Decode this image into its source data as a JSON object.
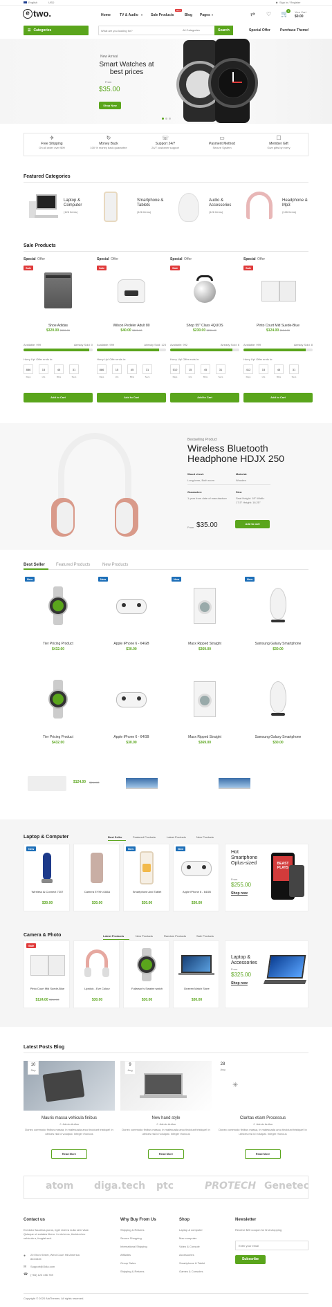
{
  "topbar": {
    "language": "English",
    "currency": "USD",
    "account": "Sign in / Register"
  },
  "header": {
    "logo": "two.",
    "logo_prefix": "e",
    "nav": [
      "Home",
      "TV & Audio",
      "Sale Products",
      "Blog",
      "Pages"
    ],
    "hot_badge": "HOT",
    "cart_label": "Your Cart",
    "cart_total": "$0.00",
    "cart_count": "0"
  },
  "searchbar": {
    "categories_label": "Categories",
    "placeholder": "What are you looking for?",
    "select": "All Categories",
    "search_button": "Search",
    "links": [
      "Special Offer",
      "Purchase Theme!"
    ]
  },
  "hero": {
    "tag": "New Arrival",
    "title": "Smart Watches at best prices",
    "from": "From",
    "price": "$35.00",
    "button": "Shop Now"
  },
  "features": [
    {
      "title": "Free Shipping",
      "sub": "On all order over $99"
    },
    {
      "title": "Money Back",
      "sub": "100 % money back guarantee"
    },
    {
      "title": "Support 24/7",
      "sub": "24/7 customer support"
    },
    {
      "title": "Payment Method",
      "sub": "Secure System"
    },
    {
      "title": "Member Gift",
      "sub": "Give gifts by every"
    }
  ],
  "featured_categories": {
    "title": "Featured Categories",
    "items": [
      {
        "name": "Laptop & Computer",
        "count": "(126 Items)"
      },
      {
        "name": "Smartphone & Tablets",
        "count": "(126 Items)"
      },
      {
        "name": "Audio & Accessories",
        "count": "(126 Items)"
      },
      {
        "name": "Headphone & Mp3",
        "count": "(126 Items)"
      }
    ]
  },
  "sale_products": {
    "title": "Sale Products",
    "special": "Special",
    "offer": "Offer",
    "sale": "Sale",
    "hurry": "Hurry Up! Offer ends in:",
    "add_to_cart": "Add to Cart",
    "labels": [
      "Days",
      "Hrs",
      "Mins",
      "Secs"
    ],
    "items": [
      {
        "name": "Shoe Adidas",
        "price": "$320.00",
        "old": "$350.00",
        "available": "Available: 999",
        "sold": "Already Sold: 0",
        "fill": 0.95,
        "cd": [
          "886",
          "15",
          "45",
          "31"
        ]
      },
      {
        "name": "Wilson Pedeler Adult 80",
        "price": "$40.00",
        "old": "$120.00",
        "available": "Available: 999",
        "sold": "Already Sold: 123",
        "fill": 0.9,
        "cd": [
          "886",
          "15",
          "45",
          "31"
        ]
      },
      {
        "name": "Shop 55\" Class 4QUOS",
        "price": "$230.00",
        "old": "$250.00",
        "available": "Available: 992",
        "sold": "Already Sold: 6",
        "fill": 0.9,
        "cd": [
          "510",
          "15",
          "45",
          "31"
        ]
      },
      {
        "name": "Pinto Court Mid Suede-Blue",
        "price": "$124.00",
        "old": "$154.00",
        "available": "Available: 999",
        "sold": "Already Sold: 8",
        "fill": 0.9,
        "cd": [
          "412",
          "15",
          "45",
          "31"
        ]
      }
    ]
  },
  "promo": {
    "tag": "Bestselling Product",
    "title": "Wireless Bluetooth Headphone HDJX 250",
    "specs": [
      {
        "label": "Wood chest:",
        "value": "Long-term, Both room"
      },
      {
        "label": "Material:",
        "value": "Wooden"
      },
      {
        "label": "Guarantee:",
        "value": "1 year from date of manufacture"
      },
      {
        "label": "Size:",
        "value": "Seat Height: 18\" Width: 17.5\" Height: 16.25\""
      }
    ],
    "from": "From",
    "price": "$35.00",
    "button": "Add to cart"
  },
  "bestseller": {
    "tabs": [
      "Best Seller",
      "Featured Products",
      "New Products"
    ],
    "new": "New",
    "items": [
      {
        "name": "Tier Pricing Product",
        "price": "$432.00"
      },
      {
        "name": "Apple iPhone 6 - 64GB",
        "price": "$30.00"
      },
      {
        "name": "Maxx Ripped Straight",
        "price": "$369.00"
      },
      {
        "name": "Samsung Galaxy Smartphone",
        "price": "$30.00"
      },
      {
        "name": "Tier Pricing Product",
        "price": "$432.00"
      },
      {
        "name": "Apple iPhone 6 - 64GB",
        "price": "$30.00"
      },
      {
        "name": "Maxx Ripped Straight",
        "price": "$369.00"
      },
      {
        "name": "Samsung Galaxy Smartphone",
        "price": "$30.00"
      }
    ],
    "strip": {
      "price": "$124.00",
      "old": "$154.00"
    }
  },
  "laptop": {
    "title": "Laptop & Computer",
    "tabs": [
      "Best Seller",
      "Featured Products",
      "Latest Products",
      "New Products"
    ],
    "new": "New",
    "items": [
      {
        "name": "Wireless Ai Connect 7207",
        "price": "$30.00"
      },
      {
        "name": "Camera EYKH-0A5A",
        "price": "$30.00"
      },
      {
        "name": "Smartphone And Tablet",
        "price": "$30.00"
      },
      {
        "name": "Apple iPhone 6 - 64GB",
        "price": "$30.00"
      }
    ],
    "ad": {
      "title": "Hot Smartphone Oplus-sized",
      "from": "From",
      "price": "$255.00",
      "link": "Shop now",
      "screen": "BEAST PLAYS"
    }
  },
  "camera": {
    "title": "Camera & Photo",
    "tabs": [
      "Latest Products",
      "New Products",
      "Random Products",
      "Sale Products"
    ],
    "sale": "Sale",
    "items": [
      {
        "name": "Pinto Court Mid Suede-Blue",
        "price": "$124.00",
        "old": "$154.00"
      },
      {
        "name": "Lipstick - Eve Colour",
        "price": "$30.00",
        "old": ""
      },
      {
        "name": "Fullarson's Swaine watch",
        "price": "$30.00",
        "old": ""
      },
      {
        "name": "Dezeen Match Store",
        "price": "$30.00",
        "old": ""
      }
    ],
    "ad": {
      "title": "Laptop & Accessories",
      "from": "From",
      "price": "$325.00",
      "link": "Shop now"
    }
  },
  "blog": {
    "title": "Latest Posts Blog",
    "read_more": "Read More",
    "posts": [
      {
        "day": "10",
        "month": "Sep",
        "title": "Mauris massa vehicula finibus",
        "author": "Admin Author",
        "excerpt": "Donec commodo finibus massa, in malesuada arcu tincidunt tristique! In ultrices nisi id volutpat. Integer rhoncus"
      },
      {
        "day": "9",
        "month": "Aug",
        "title": "New hand style",
        "author": "Admin Author",
        "excerpt": "Donec commodo finibus massa, in malesuada arcu tincidunt tristique! In ultrices nisi id volutpat. Integer rhoncus"
      },
      {
        "day": "28",
        "month": "Aug",
        "title": "Claritas etiam Processus",
        "author": "Admin Author",
        "excerpt": "Donec commodo finibus massa, in malesuada arcu tincidunt tristique! In ultrices nisi id volutpat. Integer rhoncus"
      }
    ]
  },
  "brands": [
    "atom",
    "diga.tech",
    "ptc",
    "PROTECH",
    "Genetec"
  ],
  "footer": {
    "contact": {
      "title": "Contact us",
      "text": "Est dolor faucibus purus, eget viverra nulla sem vitae. Quisque ut sodales libero. In nisi eros, tincidunt eu vehicula a, feugiat sed.",
      "address": "20 Elton Street, West Court Hill America 8404345",
      "email": "Support@Odia.com",
      "phone": "(+84) 123 456 789"
    },
    "why": {
      "title": "Why Buy From Us",
      "links": [
        "Shipping & Returns",
        "Secure Shopping",
        "International Shipping",
        "Affiliates",
        "Group Sales",
        "Shipping & Returns"
      ]
    },
    "shop": {
      "title": "Shop",
      "links": [
        "Laptop & computer",
        "Mac computer",
        "Video & Console",
        "Accessories",
        "Smartphone & Tablet",
        "Games & Consoles"
      ]
    },
    "newsletter": {
      "title": "Newsletter",
      "text": "Receive $20 coupon for first shopping",
      "placeholder": "Enter your email",
      "button": "Subscribe"
    },
    "copyright": "Copyright © 2020 AlaThemes. All rights reserved."
  },
  "colors": {
    "accent": "#5aa51c",
    "new": "#1d6fb8",
    "sale": "#e03a3a"
  }
}
